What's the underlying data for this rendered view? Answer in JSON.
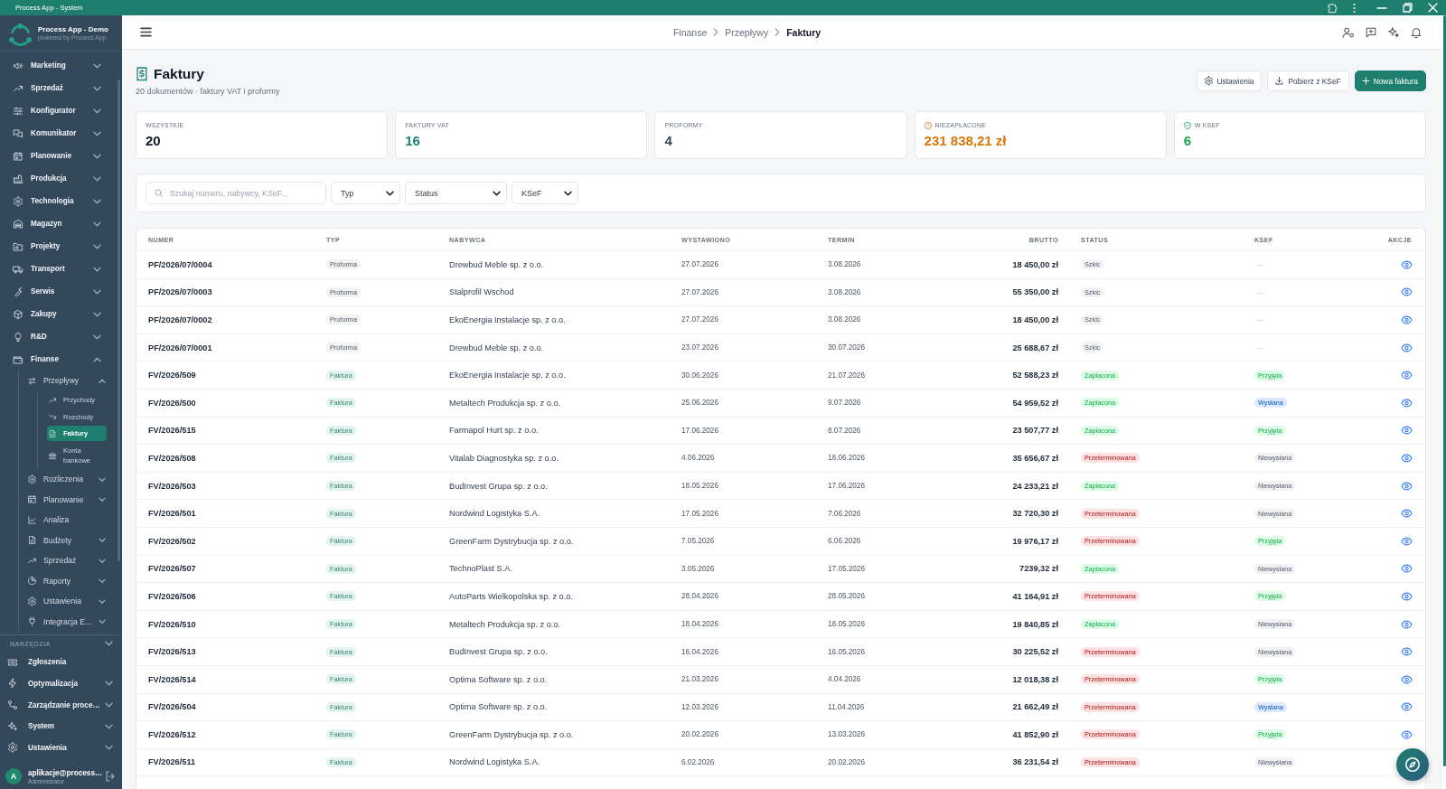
{
  "window": {
    "title": "Process App - System"
  },
  "sidebar": {
    "brand": {
      "name": "Process App - Demo",
      "tagline": "powered by Process App"
    },
    "items": [
      {
        "label": "Marketing",
        "expanded": false,
        "selected": false
      },
      {
        "label": "Sprzedaż",
        "expanded": false,
        "selected": false
      },
      {
        "label": "Konfigurator",
        "expanded": false,
        "selected": false
      },
      {
        "label": "Komunikator",
        "expanded": false,
        "selected": false
      },
      {
        "label": "Planowanie",
        "expanded": false,
        "selected": false
      },
      {
        "label": "Produkcja",
        "expanded": false,
        "selected": false
      },
      {
        "label": "Technologia",
        "expanded": false,
        "selected": false
      },
      {
        "label": "Magazyn",
        "expanded": false,
        "selected": false
      },
      {
        "label": "Projekty",
        "expanded": false,
        "selected": false
      },
      {
        "label": "Transport",
        "expanded": false,
        "selected": false
      },
      {
        "label": "Serwis",
        "expanded": false,
        "selected": false
      },
      {
        "label": "Zakupy",
        "expanded": false,
        "selected": false
      },
      {
        "label": "R&D",
        "expanded": false,
        "selected": false
      },
      {
        "label": "Finanse",
        "expanded": true,
        "selected": false,
        "children": [
          {
            "label": "Przepływy",
            "expanded": true,
            "selected": false,
            "children": [
              {
                "label": "Przychody",
                "selected": false
              },
              {
                "label": "Rozchody",
                "selected": false
              },
              {
                "label": "Faktury",
                "selected": true
              },
              {
                "label": "Konta bankowe",
                "selected": false
              }
            ]
          },
          {
            "label": "Rozliczenia",
            "expanded": false,
            "selected": false
          },
          {
            "label": "Planowanie",
            "expanded": false,
            "selected": false
          },
          {
            "label": "Analiza",
            "selected": false
          },
          {
            "label": "Budżety",
            "expanded": false,
            "selected": false
          },
          {
            "label": "Sprzedaż",
            "expanded": false,
            "selected": false
          },
          {
            "label": "Raporty",
            "expanded": false,
            "selected": false
          },
          {
            "label": "Ustawienia",
            "expanded": false,
            "selected": false
          },
          {
            "label": "Integracja E…",
            "expanded": false,
            "selected": false
          }
        ]
      }
    ],
    "tools": {
      "label": "NARZĘDZIA",
      "expanded": true,
      "items": [
        {
          "label": "Zgłoszenia",
          "selected": false
        },
        {
          "label": "Optymalizacja",
          "expanded": false,
          "selected": false
        },
        {
          "label": "Zarządzanie proce…",
          "expanded": false,
          "selected": false
        },
        {
          "label": "System",
          "expanded": false,
          "selected": false
        },
        {
          "label": "Ustawienia",
          "expanded": false,
          "selected": false
        }
      ]
    },
    "user": {
      "initial": "A",
      "email": "aplikacje@process…",
      "role": "Administrator"
    }
  },
  "header": {
    "breadcrumb": [
      "Finanse",
      "Przepływy",
      "Faktury"
    ]
  },
  "page": {
    "title": "Faktury",
    "subtitle": "20 dokumentów · faktury VAT i proformy",
    "buttons": [
      {
        "label": "Ustawienia",
        "kind": "secondary"
      },
      {
        "label": "Pobierz z KSeF",
        "kind": "secondary"
      },
      {
        "label": "Nowa faktura",
        "kind": "primary"
      }
    ]
  },
  "stats": [
    {
      "label": "WSZYSTKIE",
      "value": "20",
      "color": "#111827",
      "kind": "plain"
    },
    {
      "label": "FAKTURY VAT",
      "value": "16",
      "color": "#1e7f6e",
      "kind": "plain"
    },
    {
      "label": "PROFORMY",
      "value": "4",
      "color": "#34495e",
      "kind": "plain"
    },
    {
      "label": "NIEZAPŁACONE",
      "value": "231 838,21 zł",
      "color": "#d97706",
      "kind": "alert"
    },
    {
      "label": "W KSEF",
      "value": "6",
      "color": "#16a34a",
      "kind": "verified"
    }
  ],
  "filters": {
    "search": {
      "placeholder": "Szukaj numeru, nabywcy, KSeF..."
    },
    "selects": [
      {
        "value": "Typ"
      },
      {
        "value": "Status"
      },
      {
        "value": "KSeF"
      }
    ]
  },
  "table": {
    "columns": [
      "NUMER",
      "TYP",
      "NABYWCA",
      "WYSTAWIONO",
      "TERMIN",
      "BRUTTO",
      "STATUS",
      "KSEF",
      "AKCJE"
    ],
    "rows": [
      {
        "number": "PF/2026/07/0004",
        "type": {
          "label": "Proforma",
          "color": "#f1f2f4"
        },
        "buyer": "Drewbud Meble sp. z o.o.",
        "issued": "27.07.2026",
        "due": "3.08.2026",
        "gross": "18 450,00 zł",
        "status": {
          "label": "Szkic",
          "color": "#f1f2f4"
        },
        "ksef": {
          "kind": "none",
          "label": "—"
        }
      },
      {
        "number": "PF/2026/07/0003",
        "type": {
          "label": "Proforma",
          "color": "#f1f2f4"
        },
        "buyer": "Stalprofil Wschod",
        "issued": "27.07.2026",
        "due": "3.08.2026",
        "gross": "55 350,00 zł",
        "status": {
          "label": "Szkic",
          "color": "#f1f2f4"
        },
        "ksef": {
          "kind": "none",
          "label": "—"
        }
      },
      {
        "number": "PF/2026/07/0002",
        "type": {
          "label": "Proforma",
          "color": "#f1f2f4"
        },
        "buyer": "EkoEnergia Instalacje sp. z o.o.",
        "issued": "27.07.2026",
        "due": "3.08.2026",
        "gross": "18 450,00 zł",
        "status": {
          "label": "Szkic",
          "color": "#f1f2f4"
        },
        "ksef": {
          "kind": "none",
          "label": "—"
        }
      },
      {
        "number": "PF/2026/07/0001",
        "type": {
          "label": "Proforma",
          "color": "#f1f2f4"
        },
        "buyer": "Drewbud Meble sp. z o.o.",
        "issued": "23.07.2026",
        "due": "30.07.2026",
        "gross": "25 688,67 zł",
        "status": {
          "label": "Szkic",
          "color": "#f1f2f4"
        },
        "ksef": {
          "kind": "none",
          "label": "—"
        }
      },
      {
        "number": "FV/2026/509",
        "type": {
          "label": "Faktura",
          "color": "#e3f3ef"
        },
        "buyer": "EkoEnergia Instalacje sp. z o.o.",
        "issued": "30.06.2026",
        "due": "21.07.2026",
        "gross": "52 588,23 zł",
        "status": {
          "label": "Zapłacona",
          "color": "#dcfce7"
        },
        "ksef": {
          "kind": "badge",
          "label": "Przyjęta",
          "color": "#dcfce7"
        }
      },
      {
        "number": "FV/2026/500",
        "type": {
          "label": "Faktura",
          "color": "#e3f3ef"
        },
        "buyer": "Metaltech Produkcja sp. z o.o.",
        "issued": "25.06.2026",
        "due": "9.07.2026",
        "gross": "54 959,52 zł",
        "status": {
          "label": "Zapłacona",
          "color": "#dcfce7"
        },
        "ksef": {
          "kind": "badge",
          "label": "Wysłana",
          "color": "#dbeafe"
        }
      },
      {
        "number": "FV/2026/515",
        "type": {
          "label": "Faktura",
          "color": "#e3f3ef"
        },
        "buyer": "Farmapol Hurt sp. z o.o.",
        "issued": "17.06.2026",
        "due": "8.07.2026",
        "gross": "23 507,77 zł",
        "status": {
          "label": "Zapłacona",
          "color": "#dcfce7"
        },
        "ksef": {
          "kind": "badge",
          "label": "Przyjęta",
          "color": "#dcfce7"
        }
      },
      {
        "number": "FV/2026/508",
        "type": {
          "label": "Faktura",
          "color": "#e3f3ef"
        },
        "buyer": "Vitalab Diagnostyka sp. z o.o.",
        "issued": "4.06.2026",
        "due": "18.06.2026",
        "gross": "35 656,67 zł",
        "status": {
          "label": "Przeterminowana",
          "color": "#fee2e2"
        },
        "ksef": {
          "kind": "badge",
          "label": "Niewysłana",
          "color": "#f1f2f4"
        }
      },
      {
        "number": "FV/2026/503",
        "type": {
          "label": "Faktura",
          "color": "#e3f3ef"
        },
        "buyer": "BudInvest Grupa sp. z o.o.",
        "issued": "18.05.2026",
        "due": "17.06.2026",
        "gross": "24 233,21 zł",
        "status": {
          "label": "Zapłacona",
          "color": "#dcfce7"
        },
        "ksef": {
          "kind": "badge",
          "label": "Niewysłana",
          "color": "#f1f2f4"
        }
      },
      {
        "number": "FV/2026/501",
        "type": {
          "label": "Faktura",
          "color": "#e3f3ef"
        },
        "buyer": "Nordwind Logistyka S.A.",
        "issued": "17.05.2026",
        "due": "7.06.2026",
        "gross": "32 720,30 zł",
        "status": {
          "label": "Przeterminowana",
          "color": "#fee2e2"
        },
        "ksef": {
          "kind": "badge",
          "label": "Niewysłana",
          "color": "#f1f2f4"
        }
      },
      {
        "number": "FV/2026/502",
        "type": {
          "label": "Faktura",
          "color": "#e3f3ef"
        },
        "buyer": "GreenFarm Dystrybucja sp. z o.o.",
        "issued": "7.05.2026",
        "due": "6.06.2026",
        "gross": "19 976,17 zł",
        "status": {
          "label": "Przeterminowana",
          "color": "#fee2e2"
        },
        "ksef": {
          "kind": "badge",
          "label": "Przyjęta",
          "color": "#dcfce7"
        }
      },
      {
        "number": "FV/2026/507",
        "type": {
          "label": "Faktura",
          "color": "#e3f3ef"
        },
        "buyer": "TechnoPlast S.A.",
        "issued": "3.05.2026",
        "due": "17.05.2026",
        "gross": "7239,32 zł",
        "status": {
          "label": "Zapłacona",
          "color": "#dcfce7"
        },
        "ksef": {
          "kind": "badge",
          "label": "Niewysłana",
          "color": "#f1f2f4"
        }
      },
      {
        "number": "FV/2026/506",
        "type": {
          "label": "Faktura",
          "color": "#e3f3ef"
        },
        "buyer": "AutoParts Wielkopolska sp. z o.o.",
        "issued": "28.04.2026",
        "due": "28.05.2026",
        "gross": "41 164,91 zł",
        "status": {
          "label": "Przeterminowana",
          "color": "#fee2e2"
        },
        "ksef": {
          "kind": "badge",
          "label": "Przyjęta",
          "color": "#dcfce7"
        }
      },
      {
        "number": "FV/2026/510",
        "type": {
          "label": "Faktura",
          "color": "#e3f3ef"
        },
        "buyer": "Metaltech Produkcja sp. z o.o.",
        "issued": "18.04.2026",
        "due": "18.05.2026",
        "gross": "19 840,85 zł",
        "status": {
          "label": "Zapłacona",
          "color": "#dcfce7"
        },
        "ksef": {
          "kind": "badge",
          "label": "Niewysłana",
          "color": "#f1f2f4"
        }
      },
      {
        "number": "FV/2026/513",
        "type": {
          "label": "Faktura",
          "color": "#e3f3ef"
        },
        "buyer": "BudInvest Grupa sp. z o.o.",
        "issued": "16.04.2026",
        "due": "16.05.2026",
        "gross": "30 225,52 zł",
        "status": {
          "label": "Przeterminowana",
          "color": "#fee2e2"
        },
        "ksef": {
          "kind": "badge",
          "label": "Niewysłana",
          "color": "#f1f2f4"
        }
      },
      {
        "number": "FV/2026/514",
        "type": {
          "label": "Faktura",
          "color": "#e3f3ef"
        },
        "buyer": "Optima Software sp. z o.o.",
        "issued": "21.03.2026",
        "due": "4.04.2026",
        "gross": "12 018,38 zł",
        "status": {
          "label": "Przeterminowana",
          "color": "#fee2e2"
        },
        "ksef": {
          "kind": "badge",
          "label": "Przyjęta",
          "color": "#dcfce7"
        }
      },
      {
        "number": "FV/2026/504",
        "type": {
          "label": "Faktura",
          "color": "#e3f3ef"
        },
        "buyer": "Optima Software sp. z o.o.",
        "issued": "12.03.2026",
        "due": "11.04.2026",
        "gross": "21 662,49 zł",
        "status": {
          "label": "Przeterminowana",
          "color": "#fee2e2"
        },
        "ksef": {
          "kind": "badge",
          "label": "Wysłana",
          "color": "#dbeafe"
        }
      },
      {
        "number": "FV/2026/512",
        "type": {
          "label": "Faktura",
          "color": "#e3f3ef"
        },
        "buyer": "GreenFarm Dystrybucja sp. z o.o.",
        "issued": "20.02.2026",
        "due": "13.03.2026",
        "gross": "41 852,90 zł",
        "status": {
          "label": "Przeterminowana",
          "color": "#fee2e2"
        },
        "ksef": {
          "kind": "badge",
          "label": "Przyjęta",
          "color": "#dcfce7"
        }
      },
      {
        "number": "FV/2026/511",
        "type": {
          "label": "Faktura",
          "color": "#e3f3ef"
        },
        "buyer": "Nordwind Logistyka S.A.",
        "issued": "6.02.2026",
        "due": "20.02.2026",
        "gross": "36 231,54 zł",
        "status": {
          "label": "Przeterminowana",
          "color": "#fee2e2"
        },
        "ksef": {
          "kind": "badge",
          "label": "Niewysłana",
          "color": "#f1f2f4"
        }
      }
    ]
  }
}
